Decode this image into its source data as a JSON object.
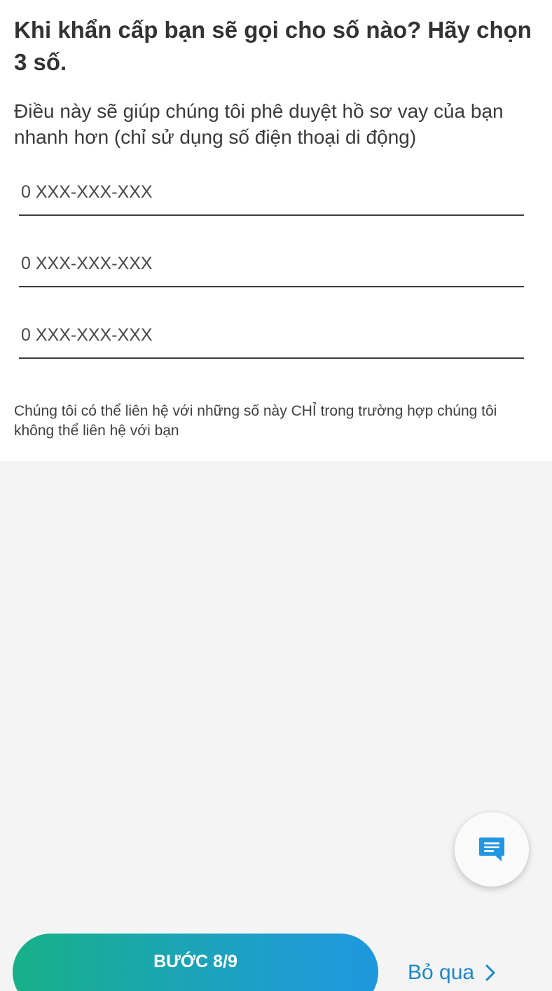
{
  "header": {
    "title": "Khi khẩn cấp bạn sẽ gọi cho số nào? Hãy chọn 3 số.",
    "subtitle": "Điều này sẽ giúp chúng tôi phê duyệt hồ sơ vay của bạn nhanh hơn (chỉ sử dụng số điện thoại di động)"
  },
  "phones": [
    {
      "value": "",
      "placeholder": "0 XXX-XXX-XXX"
    },
    {
      "value": "",
      "placeholder": "0 XXX-XXX-XXX"
    },
    {
      "value": "",
      "placeholder": "0 XXX-XXX-XXX"
    }
  ],
  "note": "Chúng tôi có thể liên hệ với những số này CHỈ trong trường hợp chúng tôi không thể liên hệ với bạn",
  "chat": {
    "icon": "chat-bubble-icon"
  },
  "footer": {
    "step_label": "BƯỚC 8/9",
    "skip_label": "Bỏ qua",
    "skip_icon": "chevron-right-icon"
  },
  "colors": {
    "accent": "#1b87c9",
    "gradient_start": "#17b088",
    "gradient_end": "#1e97de",
    "chat_icon": "#2196e3"
  }
}
